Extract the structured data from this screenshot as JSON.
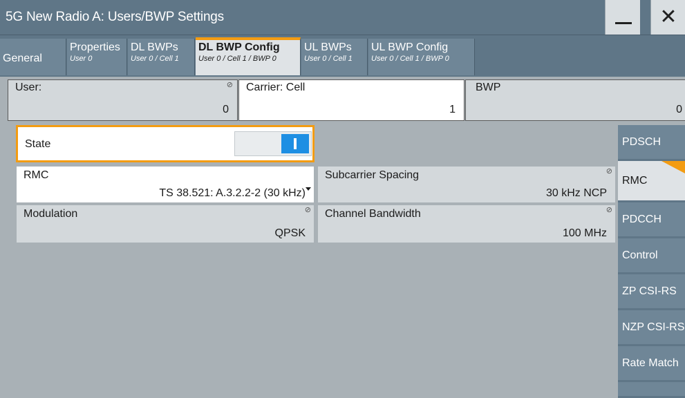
{
  "window": {
    "title": "5G New Radio A: Users/BWP Settings",
    "minimize_symbol": "—",
    "close_symbol": "✕"
  },
  "tabs": [
    {
      "name": "General",
      "sub": ""
    },
    {
      "name": "Properties",
      "sub": "User 0"
    },
    {
      "name": "DL BWPs",
      "sub": "User 0 / Cell 1"
    },
    {
      "name": "DL BWP Config",
      "sub": "User 0 / Cell 1 / BWP 0",
      "active": true
    },
    {
      "name": "UL BWPs",
      "sub": "User 0 / Cell 1"
    },
    {
      "name": "UL BWP Config",
      "sub": "User 0 / Cell 1 / BWP 0"
    }
  ],
  "header": {
    "user": {
      "label": "User:",
      "value": "0"
    },
    "carrier": {
      "label": "Carrier: Cell",
      "value": "1"
    },
    "bwp": {
      "label": "BWP",
      "value": "0"
    }
  },
  "fields": {
    "state": {
      "label": "State",
      "on": true
    },
    "rmc": {
      "label": "RMC",
      "value": "TS 38.521: A.3.2.2-2 (30 kHz)"
    },
    "subcarrier_spacing": {
      "label": "Subcarrier Spacing",
      "value": "30 kHz NCP"
    },
    "modulation": {
      "label": "Modulation",
      "value": "QPSK"
    },
    "channel_bandwidth": {
      "label": "Channel Bandwidth",
      "value": "100 MHz"
    }
  },
  "side_nav": [
    "PDSCH",
    "RMC",
    "PDCCH",
    "Control",
    "ZP CSI-RS",
    "NZP CSI-RS",
    "Rate Match"
  ],
  "side_nav_active": "RMC",
  "colors": {
    "accent": "#f39c12",
    "toggle_on": "#1e8fe3",
    "tab_bg": "#5f7687"
  }
}
